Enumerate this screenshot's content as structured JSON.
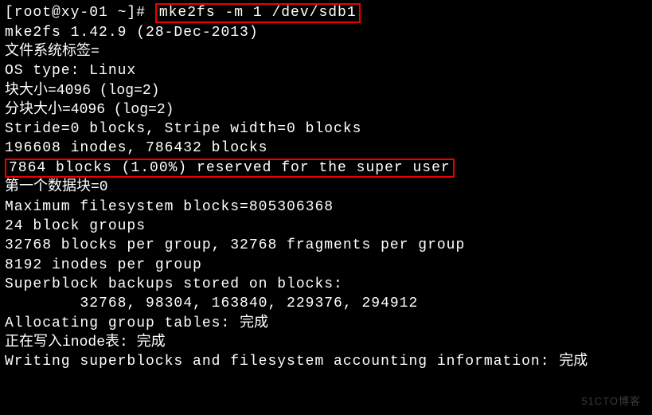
{
  "prompt": {
    "prefix": "[root@xy-01 ~]# ",
    "cmd": "mke2fs -m 1 /dev/sdb1"
  },
  "lines": {
    "l1": "mke2fs 1.42.9 (28-Dec-2013)",
    "l2": "文件系统标签=",
    "l3": "OS type: Linux",
    "l4": "块大小=4096 (log=2)",
    "l5": "分块大小=4096 (log=2)",
    "l6": "Stride=0 blocks, Stripe width=0 blocks",
    "l7": "196608 inodes, 786432 blocks",
    "l8": "7864 blocks (1.00%) reserved for the super user",
    "l9": "第一个数据块=0",
    "l10": "Maximum filesystem blocks=805306368",
    "l11": "24 block groups",
    "l12": "32768 blocks per group, 32768 fragments per group",
    "l13": "8192 inodes per group",
    "l14": "Superblock backups stored on blocks:",
    "l15": "        32768, 98304, 163840, 229376, 294912",
    "l16": "",
    "l17a": "Allocating group tables: ",
    "l17b": "完成",
    "l18a": "正在写入inode表: ",
    "l18b": "完成",
    "l19a": "Writing superblocks and filesystem accounting information: ",
    "l19b": "完成"
  },
  "watermark": "51CTO博客"
}
